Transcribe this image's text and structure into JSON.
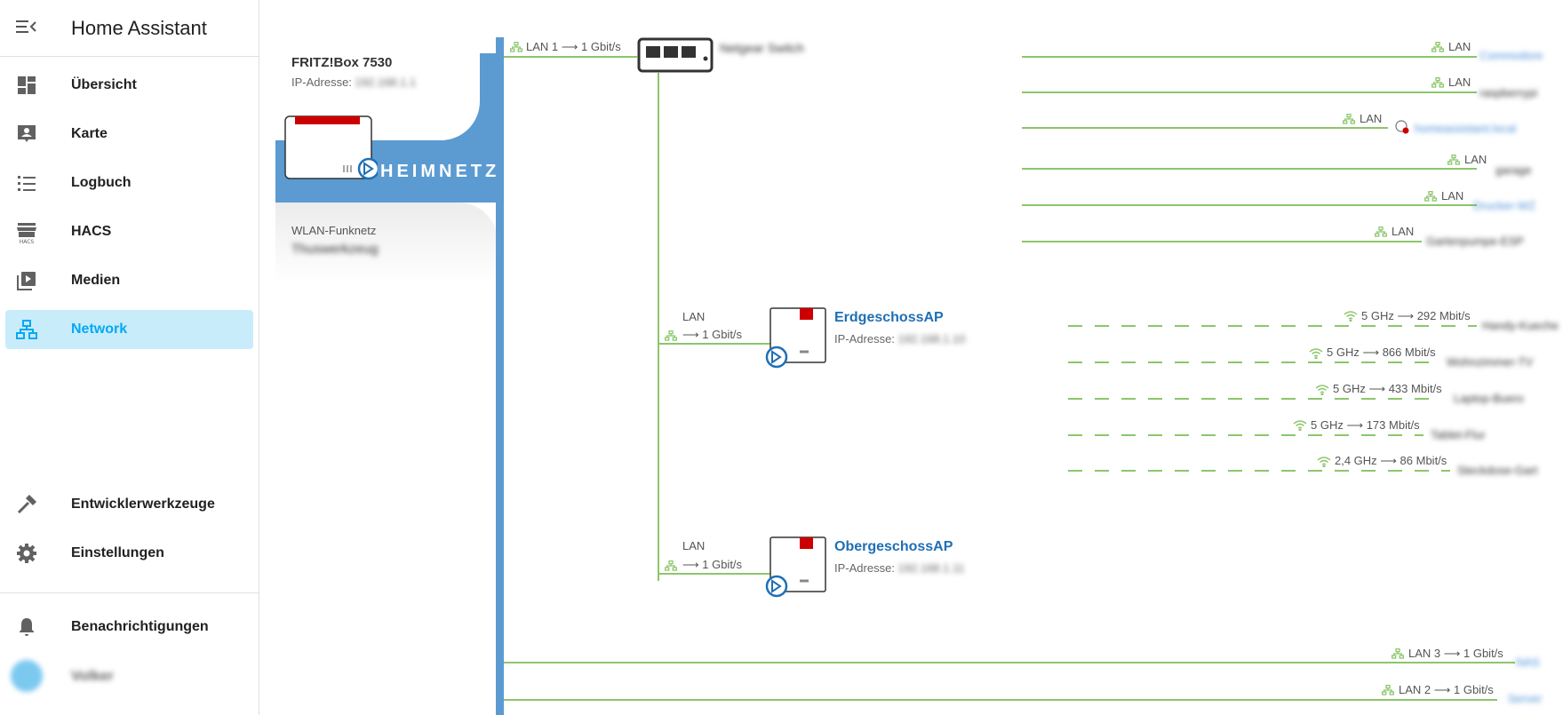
{
  "sidebar": {
    "title": "Home Assistant",
    "items": [
      {
        "label": "Übersicht",
        "icon": "dashboard-icon"
      },
      {
        "label": "Karte",
        "icon": "map-account-icon"
      },
      {
        "label": "Logbuch",
        "icon": "logbook-list-icon"
      },
      {
        "label": "HACS",
        "icon": "hacs-store-icon"
      },
      {
        "label": "Medien",
        "icon": "media-play-icon"
      },
      {
        "label": "Network",
        "icon": "network-icon",
        "active": true
      }
    ],
    "bottom_items": [
      {
        "label": "Entwicklerwerkzeuge",
        "icon": "hammer-icon"
      },
      {
        "label": "Einstellungen",
        "icon": "gear-icon"
      }
    ],
    "notifications_label": "Benachrichtigungen",
    "user_name": "Volker"
  },
  "fritz": {
    "name": "FRITZ!Box 7530",
    "ip_label": "IP-Adresse:",
    "ip_value": "192.168.1.1",
    "heimnetz": "HEIMNETZ",
    "wlan_label": "WLAN-Funknetz",
    "wlan_name": "Thuswerkzeug"
  },
  "switch": {
    "link_label": "LAN 1 ⟶ 1 Gbit/s",
    "name": "Netgear Switch"
  },
  "lan_clients": [
    {
      "label": "LAN",
      "name": "Commodore"
    },
    {
      "label": "LAN",
      "name": "raspberrypi"
    },
    {
      "label": "LAN",
      "name": "homeassistant.local"
    },
    {
      "label": "LAN",
      "name": "garage"
    },
    {
      "label": "LAN",
      "name": "Drucker-WZ"
    },
    {
      "label": "LAN",
      "name": "Gartenpumpe-ESP"
    }
  ],
  "aps": [
    {
      "name": "ErdgeschossAP",
      "ip_label": "IP-Adresse:",
      "ip_value": "192.168.1.10",
      "link_label": "LAN",
      "link_speed": "⟶ 1 Gbit/s",
      "clients": [
        {
          "label": "5 GHz ⟶ 292 Mbit/s",
          "name": "Handy-Kueche"
        },
        {
          "label": "5 GHz ⟶ 866 Mbit/s",
          "name": "Wohnzimmer-TV"
        },
        {
          "label": "5 GHz ⟶ 433 Mbit/s",
          "name": "Laptop-Buero"
        },
        {
          "label": "5 GHz ⟶ 173 Mbit/s",
          "name": "Tablet-Flur"
        },
        {
          "label": "2,4 GHz ⟶ 86 Mbit/s",
          "name": "Steckdose-Gart"
        }
      ]
    },
    {
      "name": "ObergeschossAP",
      "ip_label": "IP-Adresse:",
      "ip_value": "192.168.1.11",
      "link_label": "LAN",
      "link_speed": "⟶ 1 Gbit/s"
    }
  ],
  "direct_ports": [
    {
      "label": "LAN 3 ⟶ 1 Gbit/s",
      "name": "NAS"
    },
    {
      "label": "LAN 2 ⟶ 1 Gbit/s",
      "name": "Server"
    }
  ],
  "colors": {
    "accent": "#03a9f4",
    "active_bg": "#c9ecfa",
    "heimnetz_blue": "#5b9bd1",
    "link_green": "#8cc66b",
    "ap_blue": "#1f6fb5",
    "fritz_red": "#cc0000"
  }
}
